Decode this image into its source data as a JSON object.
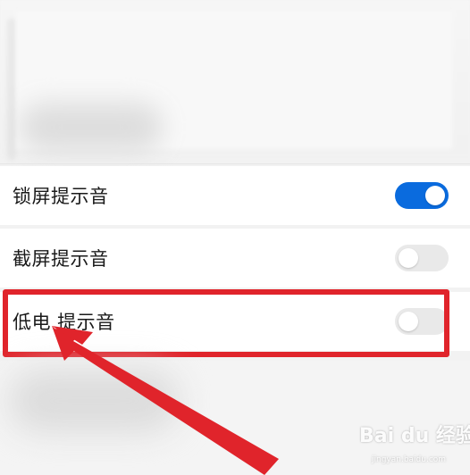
{
  "settings": {
    "items": [
      {
        "label": "锁屏提示音",
        "enabled": true
      },
      {
        "label": "截屏提示音",
        "enabled": false
      },
      {
        "label": "低电 提示音",
        "enabled": false
      }
    ]
  },
  "colors": {
    "toggle_on": "#0a6bde",
    "toggle_off": "#e9e9e9",
    "highlight": "#e0242b"
  },
  "watermark": {
    "brand": "Bai du 经验",
    "url": "jingyan.baidu.com"
  }
}
